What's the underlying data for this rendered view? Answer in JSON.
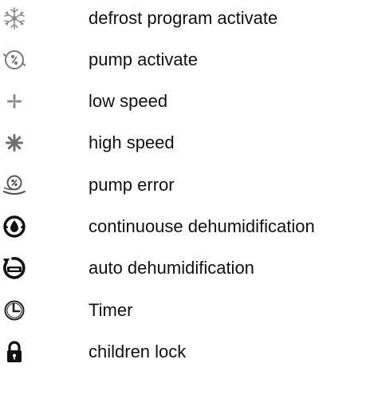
{
  "legend": {
    "items": [
      {
        "icon": "defrost-icon",
        "label": "defrost program activate"
      },
      {
        "icon": "pump-icon",
        "label": "pump activate"
      },
      {
        "icon": "low-speed-fan-icon",
        "label": "low speed"
      },
      {
        "icon": "high-speed-fan-icon",
        "label": "high speed"
      },
      {
        "icon": "pump-error-icon",
        "label": "pump error"
      },
      {
        "icon": "continuous-dehumidification-icon",
        "label": "continuouse dehumidification"
      },
      {
        "icon": "auto-dehumidification-icon",
        "label": "auto dehumidification"
      },
      {
        "icon": "timer-icon",
        "label": "Timer"
      },
      {
        "icon": "lock-icon",
        "label": "children lock"
      }
    ]
  }
}
